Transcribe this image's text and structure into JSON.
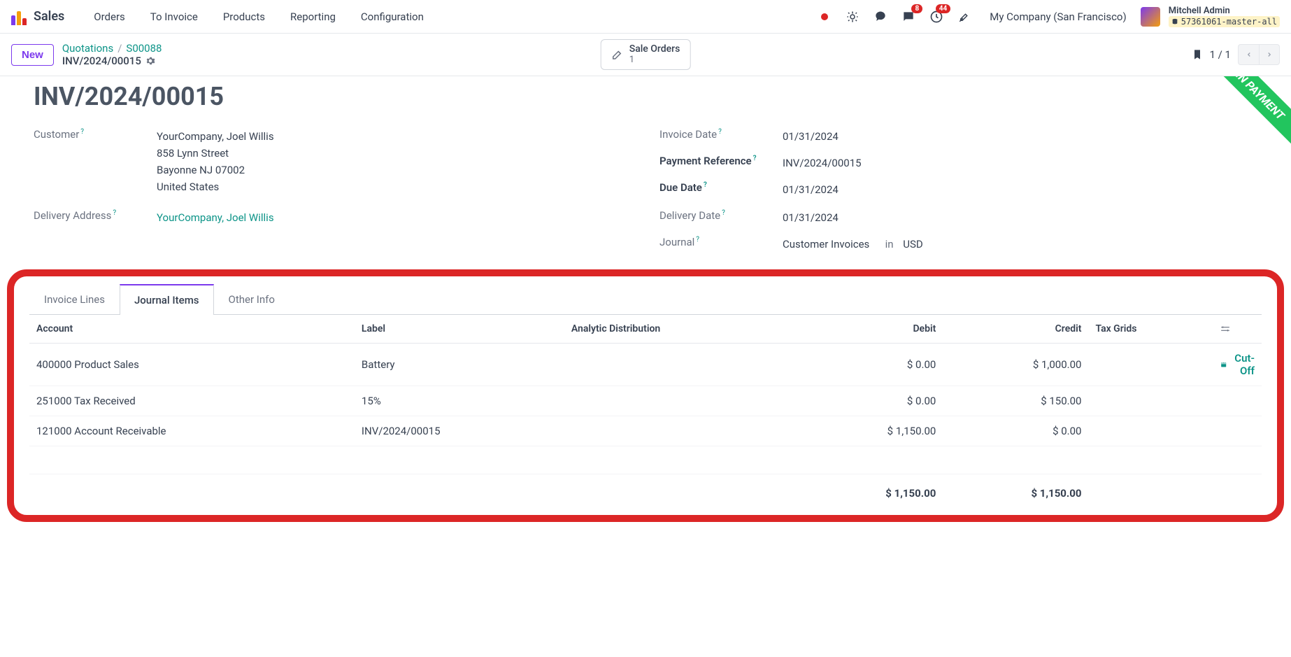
{
  "nav": {
    "app": "Sales",
    "items": [
      "Orders",
      "To Invoice",
      "Products",
      "Reporting",
      "Configuration"
    ],
    "messages_count": "8",
    "activities_count": "44",
    "company": "My Company (San Francisco)",
    "user_name": "Mitchell Admin",
    "db": "57361061-master-all"
  },
  "subbar": {
    "new": "New",
    "bc_quotations": "Quotations",
    "bc_order": "S00088",
    "bc_invoice": "INV/2024/00015",
    "sale_orders_label": "Sale Orders",
    "sale_orders_count": "1",
    "pager": "1 / 1"
  },
  "invoice": {
    "title": "INV/2024/00015",
    "ribbon": "IN PAYMENT",
    "customer_label": "Customer",
    "customer_name": "YourCompany, Joel Willis",
    "customer_addr1": "858 Lynn Street",
    "customer_addr2": "Bayonne NJ 07002",
    "customer_addr3": "United States",
    "delivery_addr_label": "Delivery Address",
    "delivery_addr": "YourCompany, Joel Willis",
    "invoice_date_label": "Invoice Date",
    "invoice_date": "01/31/2024",
    "payment_ref_label": "Payment Reference",
    "payment_ref": "INV/2024/00015",
    "due_date_label": "Due Date",
    "due_date": "01/31/2024",
    "delivery_date_label": "Delivery Date",
    "delivery_date": "01/31/2024",
    "journal_label": "Journal",
    "journal": "Customer Invoices",
    "journal_in": "in",
    "journal_currency": "USD"
  },
  "tabs": {
    "invoice_lines": "Invoice Lines",
    "journal_items": "Journal Items",
    "other_info": "Other Info"
  },
  "cols": {
    "account": "Account",
    "label": "Label",
    "analytic": "Analytic Distribution",
    "debit": "Debit",
    "credit": "Credit",
    "tax_grids": "Tax Grids"
  },
  "rows": [
    {
      "account": "400000 Product Sales",
      "label": "Battery",
      "debit": "$ 0.00",
      "credit": "$ 1,000.00",
      "cutoff": "Cut-Off"
    },
    {
      "account": "251000 Tax Received",
      "label": "15%",
      "debit": "$ 0.00",
      "credit": "$ 150.00",
      "cutoff": ""
    },
    {
      "account": "121000 Account Receivable",
      "label": "INV/2024/00015",
      "debit": "$ 1,150.00",
      "credit": "$ 0.00",
      "cutoff": ""
    }
  ],
  "totals": {
    "debit": "$ 1,150.00",
    "credit": "$ 1,150.00"
  }
}
